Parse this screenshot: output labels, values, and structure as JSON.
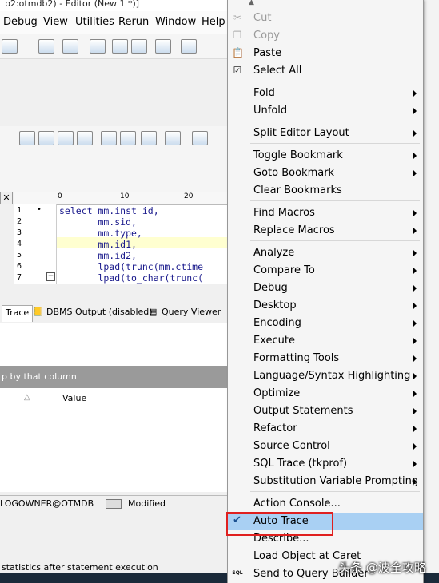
{
  "window": {
    "title": "b2:otmdb2) - Editor (New 1 *)]"
  },
  "menubar": [
    "Debug",
    "View",
    "Utilities",
    "Rerun",
    "Window",
    "Help"
  ],
  "ruler": [
    "0",
    "10",
    "20"
  ],
  "editor": {
    "line_numbers": [
      "1",
      "2",
      "3",
      "4",
      "5",
      "6",
      "7"
    ],
    "lines": [
      "select mm.inst_id,",
      "       mm.sid,",
      "       mm.type,",
      "       mm.id1,",
      "       mm.id2,",
      "       lpad(trunc(mm.ctime",
      "       lpad(to_char(trunc("
    ]
  },
  "bottom_tabs": [
    "Trace",
    "DBMS Output (disabled)",
    "Query Viewer"
  ],
  "group_hint": "p by that column",
  "grid_header": {
    "value": "Value"
  },
  "status": {
    "schema": "LOGOWNER@OTMDB",
    "state": "Modified"
  },
  "hint": "statistics after statement execution",
  "context_menu": {
    "items": [
      {
        "label": "Cut",
        "disabled": true,
        "icon": "cut-icon",
        "glyph": "✂"
      },
      {
        "label": "Copy",
        "disabled": true,
        "icon": "copy-icon",
        "glyph": "❐"
      },
      {
        "label": "Paste",
        "disabled": false,
        "icon": "paste-icon",
        "glyph": "📋"
      },
      {
        "label": "Select All",
        "disabled": false,
        "icon": "select-all-icon",
        "glyph": "☑"
      },
      {
        "label": "Fold",
        "submenu": true
      },
      {
        "label": "Unfold",
        "submenu": true
      },
      {
        "label": "Split Editor Layout",
        "submenu": true
      },
      {
        "label": "Toggle Bookmark",
        "submenu": true
      },
      {
        "label": "Goto Bookmark",
        "submenu": true
      },
      {
        "label": "Clear Bookmarks"
      },
      {
        "label": "Find Macros",
        "submenu": true
      },
      {
        "label": "Replace Macros",
        "submenu": true
      },
      {
        "label": "Analyze",
        "submenu": true
      },
      {
        "label": "Compare To",
        "submenu": true
      },
      {
        "label": "Debug",
        "submenu": true
      },
      {
        "label": "Desktop",
        "submenu": true
      },
      {
        "label": "Encoding",
        "submenu": true
      },
      {
        "label": "Execute",
        "submenu": true
      },
      {
        "label": "Formatting Tools",
        "submenu": true
      },
      {
        "label": "Language/Syntax Highlighting",
        "submenu": true
      },
      {
        "label": "Optimize",
        "submenu": true
      },
      {
        "label": "Output Statements",
        "submenu": true
      },
      {
        "label": "Refactor",
        "submenu": true
      },
      {
        "label": "Source Control",
        "submenu": true
      },
      {
        "label": "SQL Trace (tkprof)",
        "submenu": true
      },
      {
        "label": "Substitution Variable Prompting",
        "submenu": true
      },
      {
        "label": "Action Console..."
      },
      {
        "label": "Auto Trace",
        "checked": true,
        "highlighted": true
      },
      {
        "label": "Describe..."
      },
      {
        "label": "Load Object at Caret"
      },
      {
        "label": "Send to Query Builder",
        "icon": "sql-icon",
        "glyph": "SQL"
      }
    ]
  },
  "watermark": "头条 @波全攻略",
  "colors": {
    "highlight": "#a9d0f3",
    "annotation": "#e0201f"
  }
}
